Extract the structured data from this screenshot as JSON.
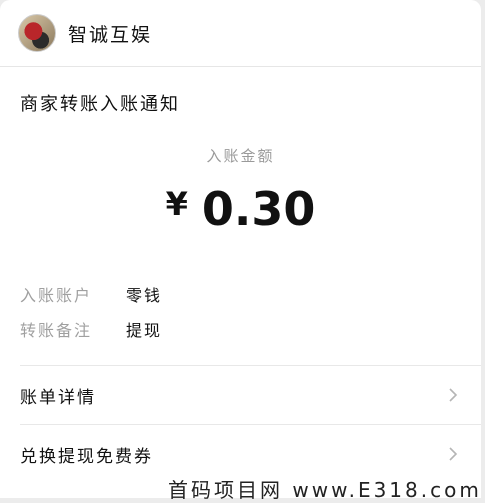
{
  "header": {
    "sender_name": "智诚互娱"
  },
  "notice": {
    "title": "商家转账入账通知"
  },
  "amount": {
    "label": "入账金额",
    "currency": "¥",
    "value": "0.30"
  },
  "details": [
    {
      "key": "入账账户",
      "value": "零钱"
    },
    {
      "key": "转账备注",
      "value": "提现"
    }
  ],
  "links": [
    {
      "label": "账单详情"
    },
    {
      "label": "兑换提现免费券"
    }
  ],
  "watermark": {
    "text": "首码项目网 www.E318.com"
  }
}
